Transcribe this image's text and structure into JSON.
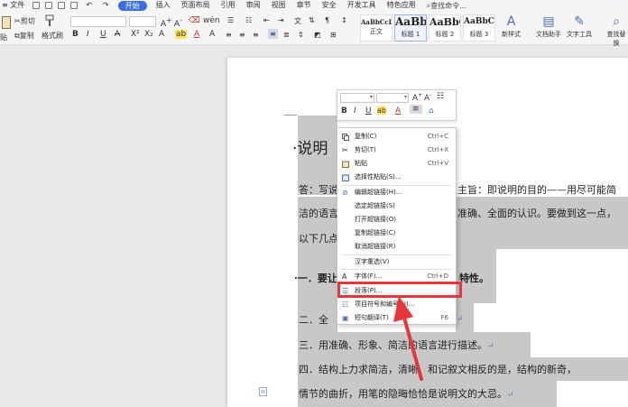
{
  "menubar": {
    "file": "文件",
    "tabs": [
      "开始",
      "插入",
      "页面布局",
      "引用",
      "审阅",
      "视图",
      "章节",
      "安全",
      "开发工具",
      "特色应用"
    ],
    "active_tab": "开始",
    "search": "查找命令..."
  },
  "ribbon": {
    "cut": "剪切",
    "paste": "贴",
    "copy": "复制",
    "format_painter": "格式刷",
    "styles": [
      {
        "sample": "AaBbCcDd",
        "label": "正文"
      },
      {
        "sample": "AaBb",
        "label": "标题 1"
      },
      {
        "sample": "AaBbC",
        "label": "标题 2"
      },
      {
        "sample": "AaBbC",
        "label": "标题 3"
      }
    ],
    "new_style": "新样式",
    "doc_helper": "文档助手",
    "text_tools": "文字工具",
    "find_replace": "查找替换"
  },
  "document": {
    "title": "说明",
    "lines": [
      "答：写说",
      "主旨：即说明的目的——用尽可能简",
      "洁的语言",
      "准确、全面的认识。要做到这一点，",
      "以下几点",
      "一．要让",
      "特性。",
      "二．全",
      "三．用准确、形象、简洁的语言进行描述。",
      "四．结构上力求简洁，清晰。和记叙文相反的是，结构的新奇，",
      "情节的曲折，用笔的隐晦恰恰是说明文的大忌。"
    ],
    "para_mark": "↵"
  },
  "context_menu": {
    "items": [
      {
        "label": "复制(C)",
        "shortcut": "Ctrl+C",
        "icon": "copy-icon"
      },
      {
        "label": "剪切(T)",
        "shortcut": "Ctrl+X",
        "icon": "scissors-icon"
      },
      {
        "label": "粘贴",
        "shortcut": "Ctrl+V",
        "icon": "paste-icon"
      },
      {
        "label": "选择性粘贴(S)...",
        "shortcut": "",
        "icon": "paste-special-icon"
      },
      {
        "label": "编辑超链接(H)...",
        "shortcut": "",
        "icon": "link-icon"
      },
      {
        "label": "选定超链接(S)",
        "shortcut": "",
        "icon": ""
      },
      {
        "label": "打开超链接(O)",
        "shortcut": "",
        "icon": ""
      },
      {
        "label": "复制超链接(C)",
        "shortcut": "",
        "icon": ""
      },
      {
        "label": "取消超链接(R)",
        "shortcut": "",
        "icon": ""
      },
      {
        "label": "汉字重选(V)",
        "shortcut": "",
        "icon": ""
      },
      {
        "label": "字体(F)...",
        "shortcut": "Ctrl+D",
        "icon": "font-icon"
      },
      {
        "label": "段落(P)...",
        "shortcut": "",
        "icon": "paragraph-icon"
      },
      {
        "label": "项目符号和编号(N)...",
        "shortcut": "",
        "icon": "list-icon"
      },
      {
        "label": "短句翻译(T)",
        "shortcut": "F6",
        "icon": "translate-icon"
      }
    ]
  },
  "colors": {
    "accent": "#3a6fe0",
    "highlight": "#c8c8c8",
    "annotation": "#e8353a"
  }
}
